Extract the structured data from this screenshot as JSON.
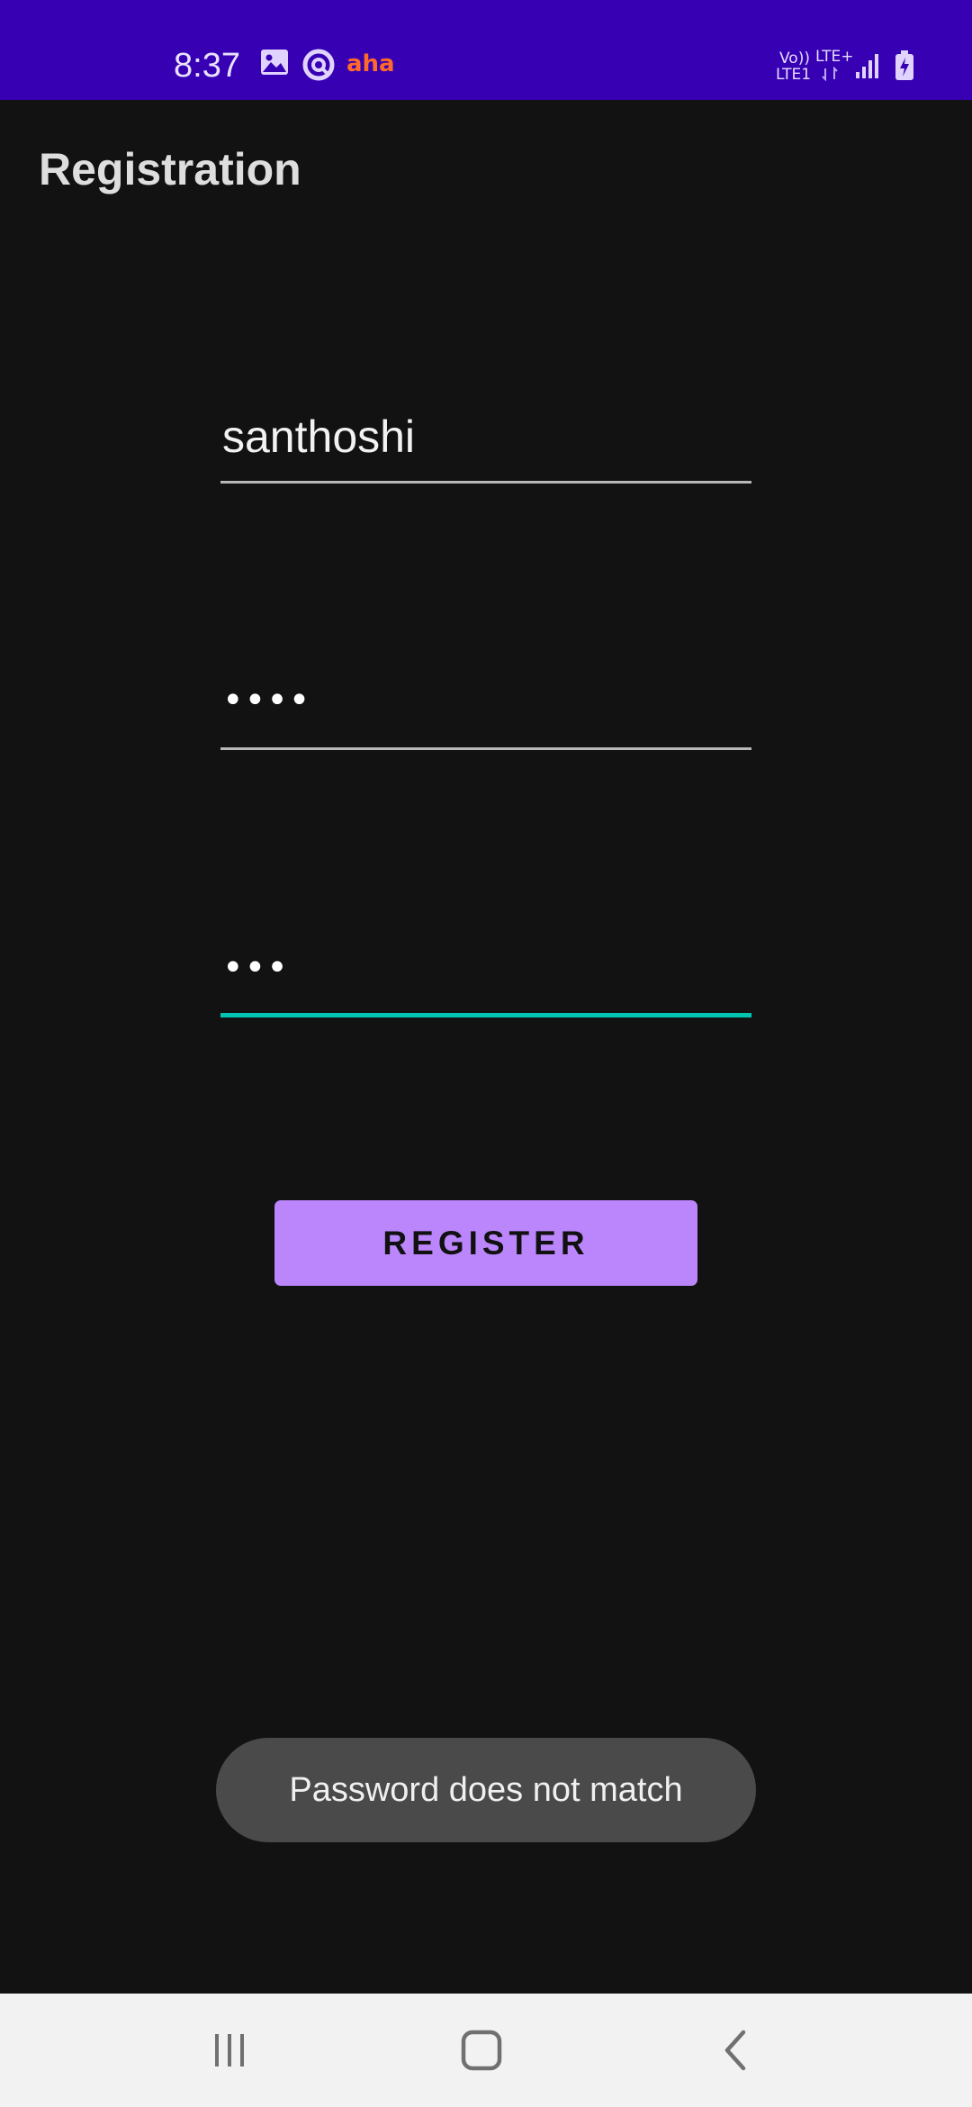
{
  "status_bar": {
    "time": "8:37",
    "aha_label": "aha",
    "network_top_left": "Vo))",
    "network_top_right": "LTE+",
    "network_bottom_left": "LTE1",
    "icons": [
      "image-icon",
      "app-circle-icon",
      "aha-logo",
      "signal-icon",
      "battery-charging-icon"
    ],
    "background_color": "#3700b3"
  },
  "app_bar": {
    "title": "Registration"
  },
  "form": {
    "username_value": "santhoshi",
    "password_masked": "••••",
    "confirm_password_masked": "•••",
    "focus_color": "#03c4b0"
  },
  "register_button": {
    "label": "REGISTER",
    "color": "#bb86fc"
  },
  "toast": {
    "message": "Password does not match"
  },
  "nav_bar": {
    "buttons": [
      "recent-apps-icon",
      "home-icon",
      "back-icon"
    ]
  }
}
